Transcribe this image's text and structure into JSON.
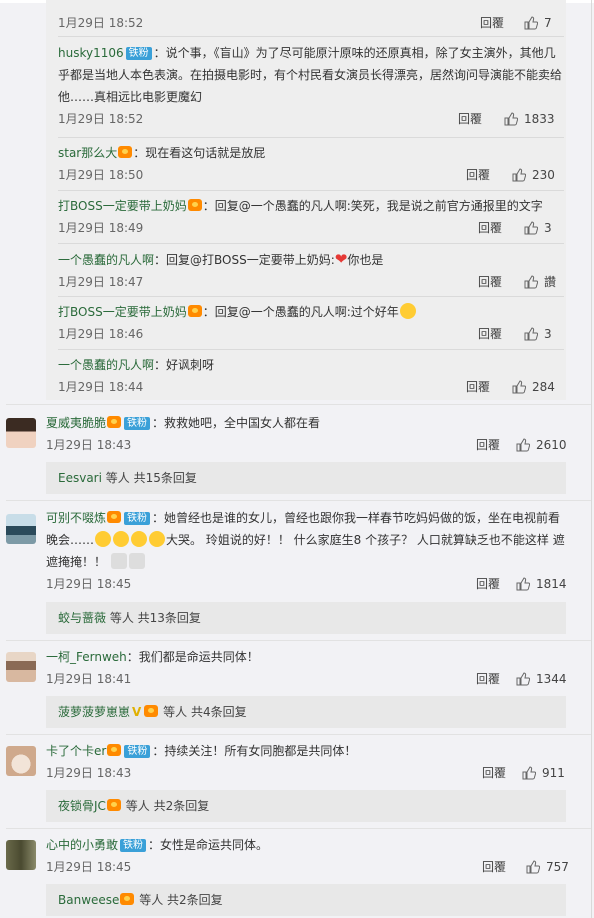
{
  "sub_replies": [
    {
      "user": "",
      "text": "",
      "time": "1月29日 18:52",
      "reply": "回覆",
      "likes": "7"
    },
    {
      "user": "husky1106",
      "badge": "铁粉",
      "text": "：说个事，《盲山》为了尽可能原汁原味的还原真相，除了女主演外，其他几乎都是当地人本色表演。在拍摄电影时，有个村民看女演员长得漂亮，居然询问导演能不能卖给他……真相远比电影更魔幻",
      "time": "1月29日 18:52",
      "reply": "回覆",
      "likes": "1833"
    },
    {
      "user": "star那么大",
      "text": "：现在看这句话就是放屁",
      "time": "1月29日 18:50",
      "reply": "回覆",
      "likes": "230"
    },
    {
      "user": "打BOSS一定要带上奶妈",
      "text": "：回复@一个愚蠢的凡人啊:笑死，我是说之前官方通报里的文字",
      "time": "1月29日 18:49",
      "reply": "回覆",
      "likes": "3"
    },
    {
      "user": "一个愚蠢的凡人啊",
      "text": "：回复@打BOSS一定要带上奶妈:",
      "text_tail": "你也是",
      "time": "1月29日 18:47",
      "reply": "回覆",
      "likes": "讚"
    },
    {
      "user": "打BOSS一定要带上奶妈",
      "text": "：回复@一个愚蠢的凡人啊:过个好年",
      "time": "1月29日 18:46",
      "reply": "回覆",
      "likes": "3"
    },
    {
      "user": "一个愚蠢的凡人啊",
      "text": "：好讽刺呀",
      "time": "1月29日 18:44",
      "reply": "回覆",
      "likes": "284"
    }
  ],
  "comments": [
    {
      "user": "夏威夷脆脆",
      "badge": "铁粉",
      "text": "：救救她吧，全中国女人都在看",
      "time": "1月29日 18:43",
      "reply": "回覆",
      "likes": "2610",
      "more_user": "Eesvari",
      "more_text": "等人 共15条回复"
    },
    {
      "user": "可别不啜炼",
      "badge": "铁粉",
      "text": "：她曾经也是谁的女儿，曾经也跟你我一样春节吃妈妈做的饭，坐在电视前看晚会……",
      "text2": "大哭。 玲姐说的好！！ 什么家庭生8 个孩子？ 人口就算缺乏也不能这样 遮遮掩掩！！",
      "time": "1月29日 18:45",
      "reply": "回覆",
      "likes": "1814",
      "more_user": "蛟与蔷薇",
      "more_text": "等人 共13条回复"
    },
    {
      "user": "一柯_Fernweh",
      "text": "：我们都是命运共同体！",
      "time": "1月29日 18:41",
      "reply": "回覆",
      "likes": "1344",
      "more_user": "菠萝菠萝崽崽",
      "more_text": "等人 共4条回复"
    },
    {
      "user": "卡了个卡er",
      "badge": "铁粉",
      "text": "：持续关注！所有女同胞都是共同体！",
      "time": "1月29日 18:43",
      "reply": "回覆",
      "likes": "911",
      "more_user": "夜锁骨JC",
      "more_text": "等人 共2条回复"
    },
    {
      "user": "心中的小勇敢",
      "badge": "铁粉",
      "text": "：女性是命运共同体。",
      "time": "1月29日 18:45",
      "reply": "回覆",
      "likes": "757",
      "more_user": "Banweese",
      "more_text": "等人 共2条回复"
    }
  ],
  "colors": {
    "username": "#2a6a3a",
    "badge": "#3aa0d8",
    "background": "#f2f2f5",
    "panel": "#eeeeee"
  }
}
